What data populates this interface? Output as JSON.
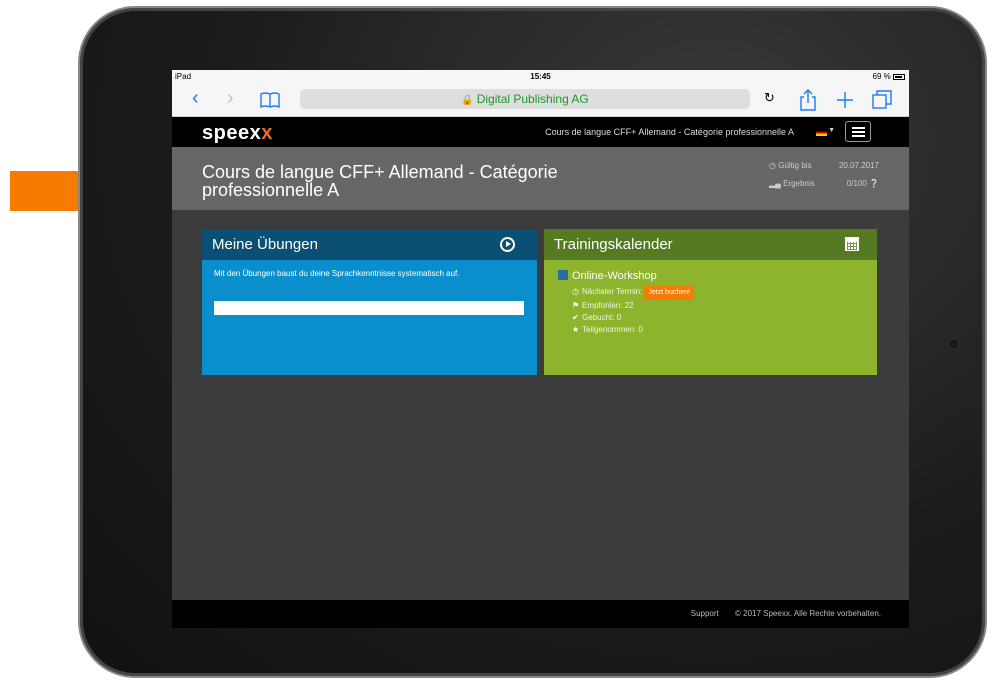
{
  "status_bar": {
    "device": "iPad",
    "time": "15:45",
    "battery": "69 %"
  },
  "browser": {
    "url_label": "Digital Publishing AG"
  },
  "app": {
    "logo_main": "speex",
    "logo_x": "x",
    "header_course": "Cours de langue CFF+ Allemand - Catégorie professionnelle A"
  },
  "course": {
    "title": "Cours de langue CFF+ Allemand - Catégorie professionnelle A",
    "valid_label": "Gültig bis",
    "valid_value": "20.07.2017",
    "result_label": "Ergebnis",
    "result_value": "0/100"
  },
  "exercises": {
    "title": "Meine Übungen",
    "description": "Mit den Übungen baust du deine Sprachkenntnisse systematisch auf.",
    "progress": 0
  },
  "calendar": {
    "title": "Trainingskalender",
    "workshop": "Online-Workshop",
    "next_label": "Nächster Termin:",
    "book_label": "Jetzt buchen!",
    "recommended": "Empfohlen: 22",
    "booked": "Gebucht: 0",
    "attended": "Teilgenommen: 0"
  },
  "footer": {
    "support": "Support",
    "copyright": "© 2017 Speexx. Alle Rechte vorbehalten."
  },
  "colors": {
    "accent": "#f26b1d",
    "blue_card": "#0a8fcc",
    "green_card": "#8db42c",
    "arrow": "#f57c00"
  }
}
